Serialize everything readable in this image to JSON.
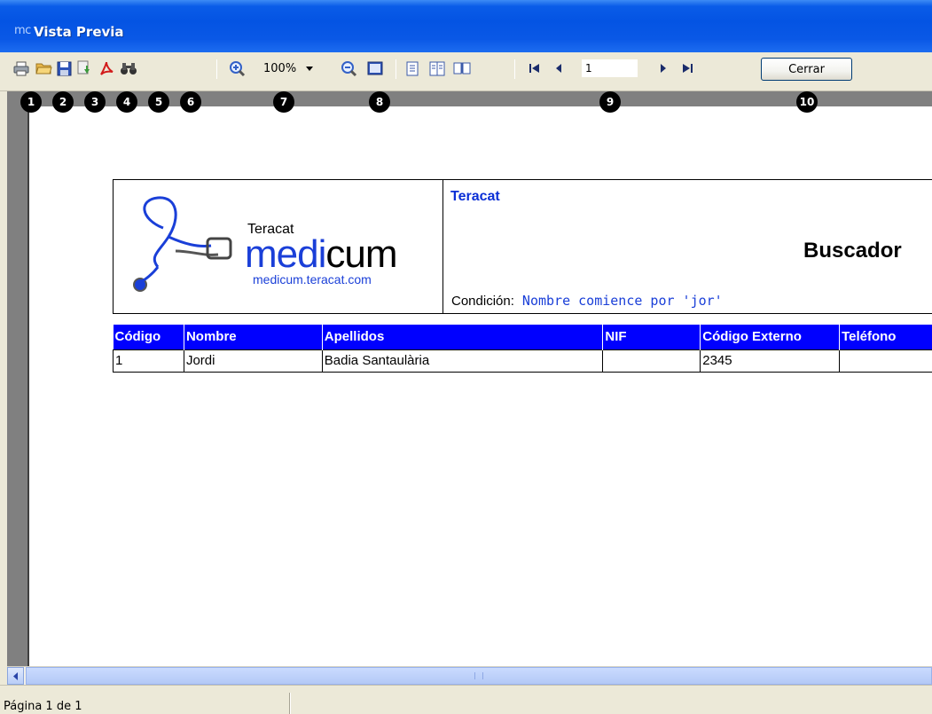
{
  "window": {
    "app_icon_text": "mc",
    "title": "Vista Previa"
  },
  "toolbar": {
    "buttons": [
      {
        "icon": "printer-icon"
      },
      {
        "icon": "folder-open-icon"
      },
      {
        "icon": "floppy-save-icon"
      },
      {
        "icon": "export-icon"
      },
      {
        "icon": "pdf-icon"
      },
      {
        "icon": "binoculars-find-icon"
      },
      {
        "icon": "zoom-in-icon"
      },
      {
        "icon": "zoom-out-icon"
      },
      {
        "icon": "page-width-icon"
      },
      {
        "icon": "single-page-icon"
      },
      {
        "icon": "two-pages-icon"
      },
      {
        "icon": "book-view-icon"
      },
      {
        "icon": "first-page-icon"
      },
      {
        "icon": "previous-page-icon"
      },
      {
        "icon": "next-page-icon"
      },
      {
        "icon": "last-page-icon"
      }
    ],
    "zoom_value": "100%",
    "page_number": "1",
    "close_label": "Cerrar"
  },
  "badges": [
    "1",
    "2",
    "3",
    "4",
    "5",
    "6",
    "7",
    "8",
    "9",
    "10"
  ],
  "report": {
    "logo": {
      "small": "Teracat",
      "big_a": "medi",
      "big_b": "cum",
      "url": "medicum.teracat.com"
    },
    "company": "Teracat",
    "title": "Buscador",
    "condition_label": "Condición:",
    "condition_value": "Nombre comience por 'jor'",
    "table": {
      "headers": [
        "Código",
        "Nombre",
        "Apellidos",
        "NIF",
        "Código Externo",
        "Teléfono"
      ],
      "rows": [
        [
          "1",
          "Jordi",
          "Badia Santaulària",
          "",
          "2345",
          ""
        ]
      ]
    }
  },
  "status": {
    "page_info": "Página 1 de 1"
  }
}
